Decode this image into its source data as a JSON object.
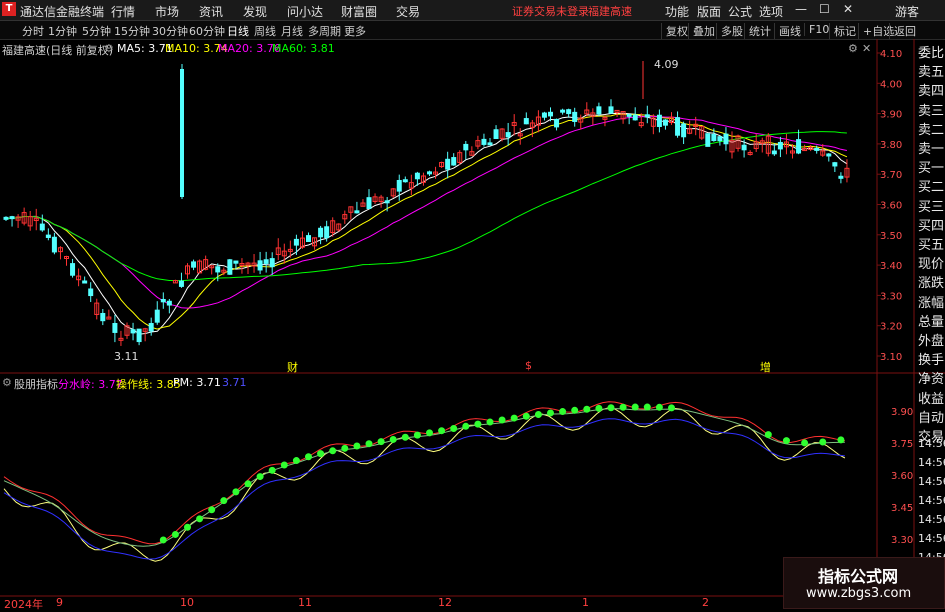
{
  "titlebar": {
    "app_name": "通达信金融终端",
    "menu": [
      "行情",
      "市场",
      "资讯",
      "发现",
      "问小达",
      "财富圈",
      "交易"
    ],
    "warning": "证券交易未登录",
    "stock": "福建高速",
    "right_menu": [
      "功能",
      "版面",
      "公式",
      "选项"
    ],
    "guest": "游客"
  },
  "toolbar": {
    "timeframes": [
      "分时",
      "1分钟",
      "5分钟",
      "15分钟",
      "30分钟",
      "60分钟",
      "日线",
      "周线",
      "月线",
      "多周期",
      "更多"
    ],
    "active": "日线",
    "buttons": [
      "复权",
      "叠加",
      "多股",
      "统计",
      "画线",
      "F10",
      "标记",
      "+自选",
      "返回"
    ]
  },
  "main_chart": {
    "legend_title": "福建高速(日线 前复权)",
    "ma5": "MA5: 3.71",
    "ma10": "MA10: 3.74",
    "ma20": "MA20: 3.76",
    "ma60": "MA60: 3.81",
    "high_label": "4.09",
    "low_label": "3.11",
    "markers": [
      "财",
      "$",
      "增"
    ],
    "price_ticks": [
      "4.10",
      "4.00",
      "3.90",
      "3.80",
      "3.70",
      "3.60",
      "3.50",
      "3.40",
      "3.30",
      "3.20",
      "3.10"
    ],
    "colors": {
      "up": "#ff3333",
      "down": "#54ffff",
      "ma5": "#ffffff",
      "ma10": "#ffff00",
      "ma20": "#ff00ff",
      "ma60": "#00ff00"
    }
  },
  "sub_chart": {
    "indicator_name": "股朋指标",
    "line1": "分水岭: 3.77",
    "line2": "操作线: 3.85",
    "line3": "PM: 3.71",
    "line4": "3.71",
    "ticks": [
      "3.90",
      "3.75",
      "3.60",
      "3.45",
      "3.30"
    ]
  },
  "date_axis": [
    "2024年",
    "9",
    "10",
    "11",
    "12",
    "1",
    "2"
  ],
  "right_panel": [
    "委比",
    "卖五",
    "卖四",
    "卖三",
    "卖二",
    "卖一",
    "买一",
    "买二",
    "买三",
    "买四",
    "买五",
    "现价",
    "涨跌",
    "涨幅",
    "总量",
    "外盘",
    "换手",
    "净资",
    "收益",
    "自动",
    "交易"
  ],
  "right_times": [
    "14:56",
    "14:56",
    "14:56",
    "14:56",
    "14:56",
    "14:56",
    "14:56",
    "14:56",
    "14:56"
  ],
  "watermark": {
    "title": "指标公式网",
    "url": "www.zbgs3.com"
  }
}
